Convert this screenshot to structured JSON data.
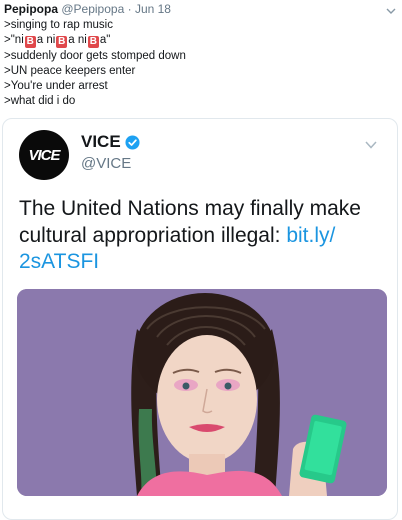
{
  "outer_tweet": {
    "display_name": "Pepipopa",
    "handle": "@Pepipopa",
    "separator": "·",
    "date": "Jun 18",
    "lines": [
      ">singing to rap music",
      ">\"ni",
      "a ni",
      "a ni",
      "a\"",
      ">suddenly door gets stomped down",
      ">UN peace keepers enter",
      ">You're under arrest",
      ">what did i do"
    ],
    "emoji_letter": "B"
  },
  "quoted_tweet": {
    "avatar_text": "VICE",
    "display_name": "VICE",
    "handle": "@VICE",
    "text": "The United Nations may finally make cultural appropriation illegal: ",
    "link": "bit.ly/\n2sATSFI"
  },
  "colors": {
    "link": "#1b95e0",
    "verified": "#1da1f2",
    "emoji_bg": "#e0484b",
    "media_bg": "#8b79ad"
  }
}
